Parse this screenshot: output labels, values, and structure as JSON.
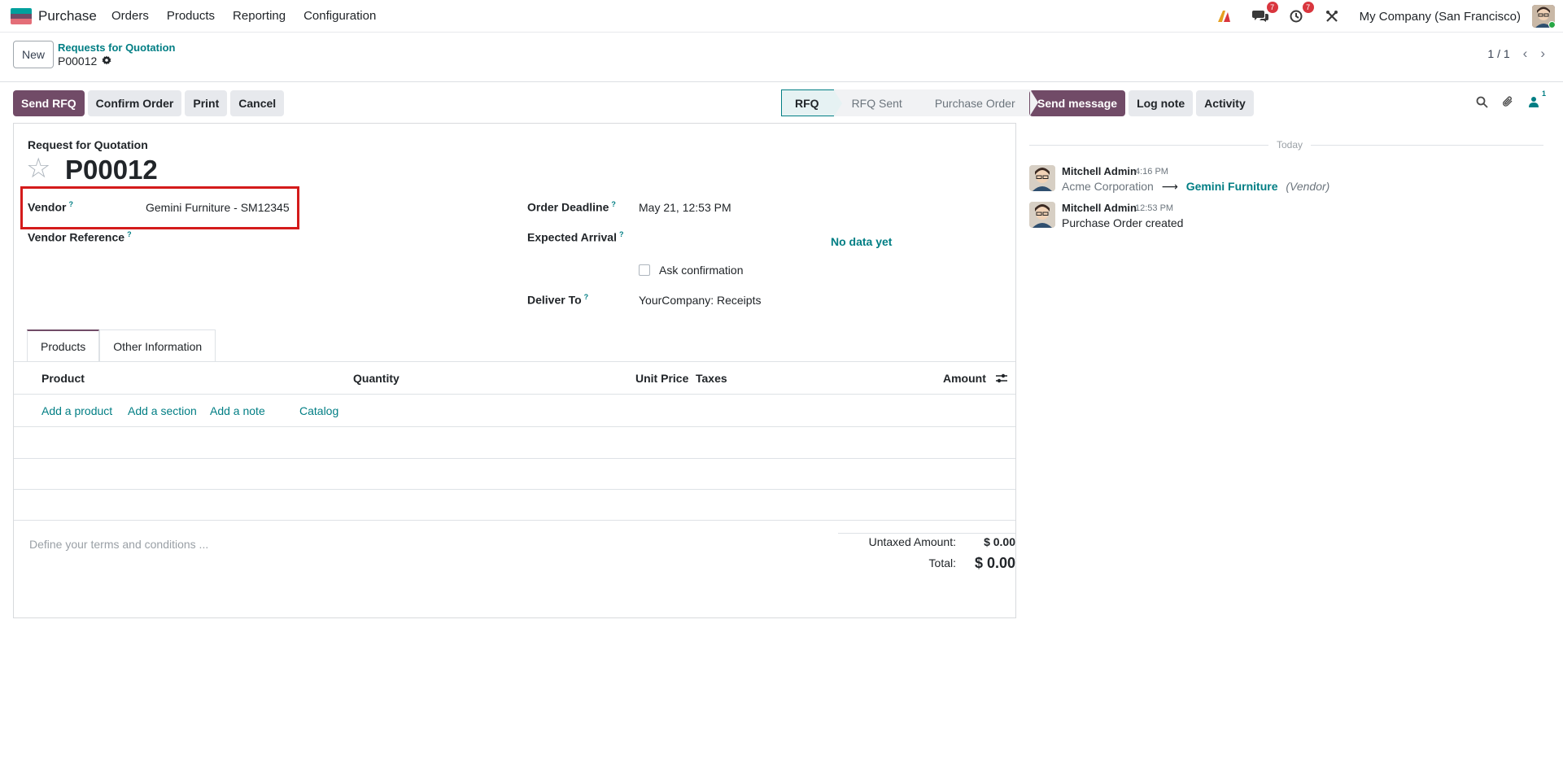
{
  "navbar": {
    "app_name": "Purchase",
    "menu": [
      "Orders",
      "Products",
      "Reporting",
      "Configuration"
    ],
    "messages_count": "7",
    "activities_count": "7",
    "company": "My Company (San Francisco)",
    "logo_colors": [
      "#00a09d",
      "#714b67",
      "#e46e78"
    ]
  },
  "control_panel": {
    "new_label": "New",
    "breadcrumb": "Requests for Quotation",
    "record": "P00012",
    "pager": "1 / 1"
  },
  "actions": {
    "send_rfq": "Send RFQ",
    "confirm": "Confirm Order",
    "print": "Print",
    "cancel": "Cancel"
  },
  "statusbar": [
    "RFQ",
    "RFQ Sent",
    "Purchase Order"
  ],
  "form": {
    "subtitle": "Request for Quotation",
    "title": "P00012",
    "vendor_label": "Vendor",
    "vendor_value": "Gemini Furniture - SM12345",
    "vendor_ref_label": "Vendor Reference",
    "deadline_label": "Order Deadline",
    "deadline_value": "May 21, 12:53 PM",
    "arrival_label": "Expected Arrival",
    "arrival_no_data": "No data yet",
    "ask_confirmation": "Ask confirmation",
    "deliver_label": "Deliver To",
    "deliver_value": "YourCompany: Receipts",
    "help_mark": "?"
  },
  "tabs": [
    "Products",
    "Other Information"
  ],
  "table": {
    "columns": [
      "Product",
      "Quantity",
      "Unit Price",
      "Taxes",
      "Amount"
    ],
    "add_links": [
      "Add a product",
      "Add a section",
      "Add a note",
      "Catalog"
    ]
  },
  "footer": {
    "terms_placeholder": "Define your terms and conditions ...",
    "untaxed_label": "Untaxed Amount:",
    "untaxed_value": "$ 0.00",
    "total_label": "Total:",
    "total_value": "$ 0.00"
  },
  "chatter": {
    "send_message": "Send message",
    "log_note": "Log note",
    "activity": "Activity",
    "followers_count": "1",
    "today": "Today",
    "messages": [
      {
        "author": "Mitchell Admin",
        "time": "4:16 PM",
        "old_value": "Acme Corporation",
        "new_value": "Gemini Furniture",
        "field": "(Vendor)"
      },
      {
        "author": "Mitchell Admin",
        "time": "12:53 PM",
        "body": "Purchase Order created"
      }
    ]
  }
}
